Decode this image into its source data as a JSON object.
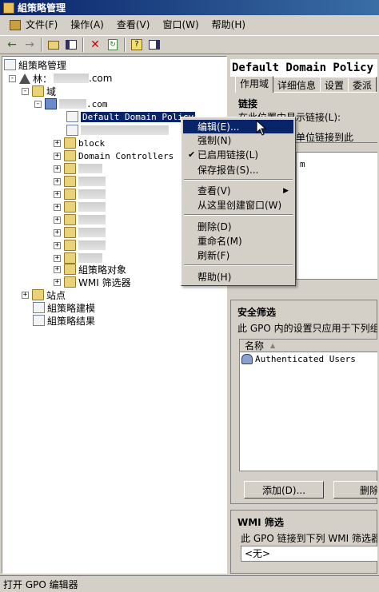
{
  "window": {
    "title": "組策略管理"
  },
  "menu": [
    {
      "label": "文件(F)"
    },
    {
      "label": "操作(A)"
    },
    {
      "label": "查看(V)"
    },
    {
      "label": "窗口(W)"
    },
    {
      "label": "帮助(H)"
    }
  ],
  "tree": {
    "root": "組策略管理",
    "forest_prefix": "林：",
    "forest_suffix": ".com",
    "domains": "域",
    "domain_suffix": ".com",
    "default_policy": "Default Domain Policy",
    "block": "block",
    "domain_controllers": "Domain Controllers",
    "gpo_objects": "組策略对象",
    "wmi_filters": "WMI 筛选器",
    "sites": "站点",
    "modeling": "組策略建模",
    "results": "組策略结果"
  },
  "right": {
    "title": "Default Domain Policy",
    "tabs": [
      "作用域",
      "详细信息",
      "设置",
      "委派"
    ],
    "links_header": "链接",
    "links_label": "在此位置中显示链接(L):",
    "links_desc": "和组织单位链接到此",
    "links_col": "m",
    "security_header": "安全筛选",
    "security_desc": "此 GPO 内的设置只应用于下列组",
    "col_name": "名称",
    "row_user": "Authenticated Users",
    "btn_add": "添加(D)...",
    "btn_remove": "删除",
    "wmi_header": "WMI 筛选",
    "wmi_desc": "此 GPO 链接到下列 WMI 筛选器",
    "wmi_value": "<无>"
  },
  "context_menu": {
    "edit": "编辑(E)...",
    "enforce": "强制(N)",
    "link_enabled": "已启用链接(L)",
    "save_report": "保存报告(S)...",
    "view": "查看(V)",
    "new_window": "从这里创建窗口(W)",
    "delete": "删除(D)",
    "rename": "重命名(M)",
    "refresh": "刷新(F)",
    "help": "帮助(H)"
  },
  "status": {
    "text": "打开 GPO 编辑器"
  },
  "colors": {
    "title_start": "#0a246a",
    "title_end": "#3a6ea5",
    "highlight": "#0a246a"
  },
  "icons": [
    "back-icon",
    "forward-icon",
    "up-folder-icon",
    "show-hide-tree-icon",
    "delete-icon",
    "refresh-icon",
    "help-icon",
    "console-icon"
  ]
}
